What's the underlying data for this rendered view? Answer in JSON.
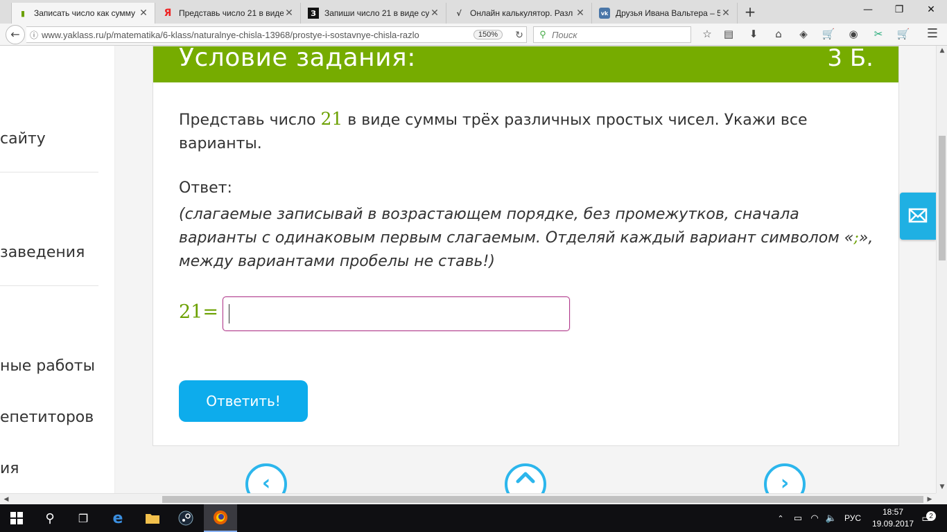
{
  "browser": {
    "tabs": [
      {
        "title": "Записать число как сумму",
        "icon": "yaklass-book-icon",
        "active": true
      },
      {
        "title": "Представь число 21 в виде",
        "icon": "yandex-icon",
        "active": false
      },
      {
        "title": "Запиши число 21 в виде су",
        "icon": "znanija-icon",
        "active": false
      },
      {
        "title": "Онлайн калькулятор. Разл",
        "icon": "calculator-icon",
        "active": false
      },
      {
        "title": "Друзья Ивана Вальтера – 5(",
        "icon": "vk-icon",
        "active": false
      }
    ],
    "url": "www.yaklass.ru/p/matematika/6-klass/naturalnye-chisla-13968/prostye-i-sostavnye-chisla-razlo",
    "zoom": "150%",
    "search_placeholder": "Поиск",
    "tab_icon_glyphs": {
      "yaklass": "▮",
      "yandex": "Я",
      "znanija": "З",
      "calc": "√",
      "vk": "vk"
    }
  },
  "sidebar": {
    "items": [
      "сайту",
      "заведения",
      "ные работы",
      "епетиторов",
      "ия"
    ]
  },
  "task": {
    "header_title": "Условие задания:",
    "points": "3 Б.",
    "question_part1": "Представь число ",
    "question_number": "21",
    "question_part2": " в виде суммы трёх различных простых чисел. Укажи все варианты.",
    "answer_label": "Ответ:",
    "hint_part1": "(слагаемые записывай в возрастающем порядке, без промежутков, сначала варианты с одинаковым первым слагаемым. Отделяй каждый вариант символом «",
    "hint_symbol": ";",
    "hint_part2": "», между вариантами пробелы не ставь!)",
    "equation_label": "21=",
    "answer_value": "",
    "submit_label": "Ответить!"
  },
  "taskbar": {
    "language": "РУС",
    "time": "18:57",
    "date": "19.09.2017",
    "notifications": "2"
  },
  "colors": {
    "header_green": "#76ac00",
    "math_green": "#6ba000",
    "button_blue": "#0dacec",
    "input_border": "#b03a8b"
  }
}
